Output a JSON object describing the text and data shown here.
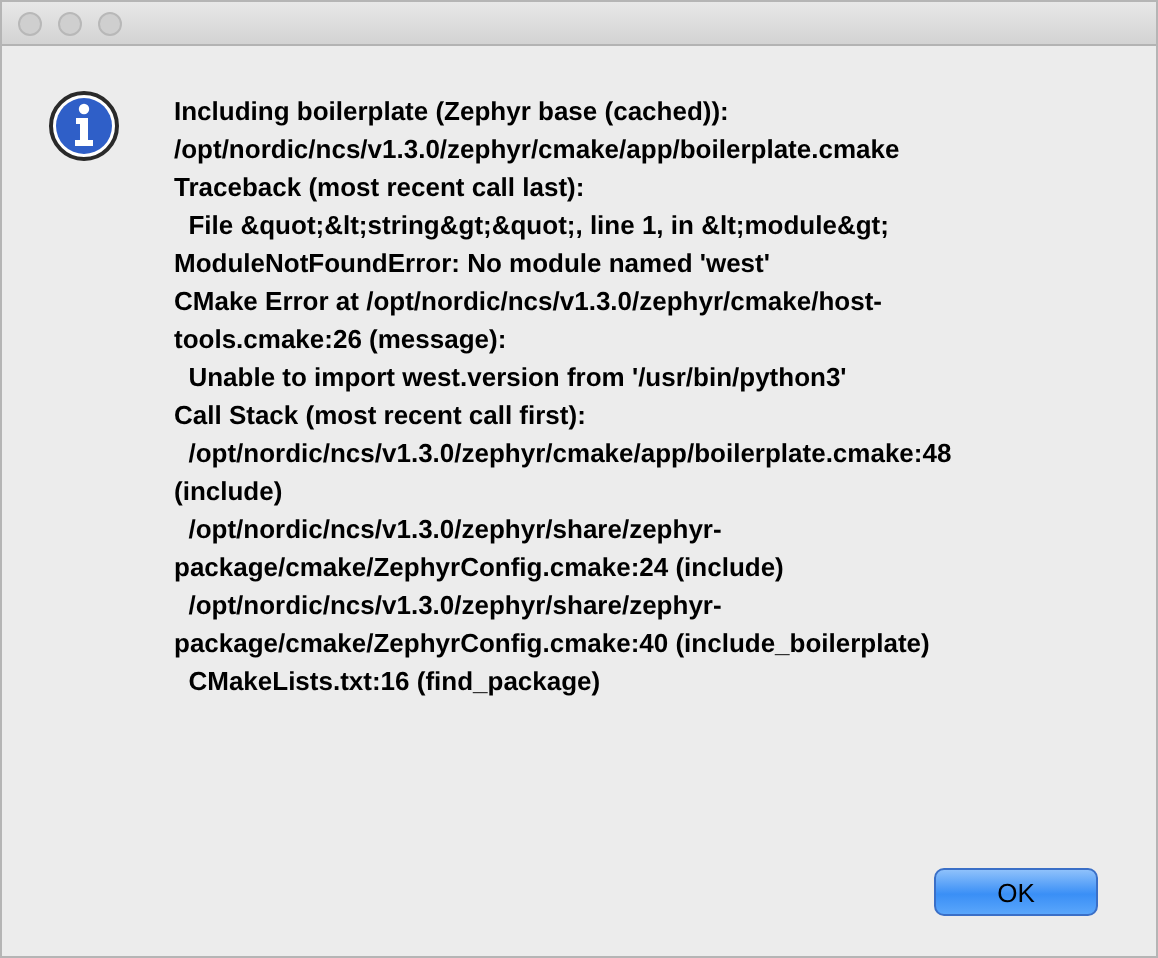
{
  "message_lines": [
    "Including boilerplate (Zephyr base (cached)):",
    "/opt/nordic/ncs/v1.3.0/zephyr/cmake/app/boilerplate.cmake",
    "Traceback (most recent call last):",
    "  File &quot;&lt;string&gt;&quot;, line 1, in &lt;module&gt;",
    "ModuleNotFoundError: No module named 'west'",
    "CMake Error at /opt/nordic/ncs/v1.3.0/zephyr/cmake/host-",
    "tools.cmake:26 (message):",
    "  Unable to import west.version from '/usr/bin/python3'",
    "Call Stack (most recent call first):",
    "  /opt/nordic/ncs/v1.3.0/zephyr/cmake/app/boilerplate.cmake:48",
    "(include)",
    "  /opt/nordic/ncs/v1.3.0/zephyr/share/zephyr-",
    "package/cmake/ZephyrConfig.cmake:24 (include)",
    "  /opt/nordic/ncs/v1.3.0/zephyr/share/zephyr-",
    "package/cmake/ZephyrConfig.cmake:40 (include_boilerplate)",
    "  CMakeLists.txt:16 (find_package)"
  ],
  "buttons": [
    {
      "label": "OK",
      "default": true
    }
  ]
}
